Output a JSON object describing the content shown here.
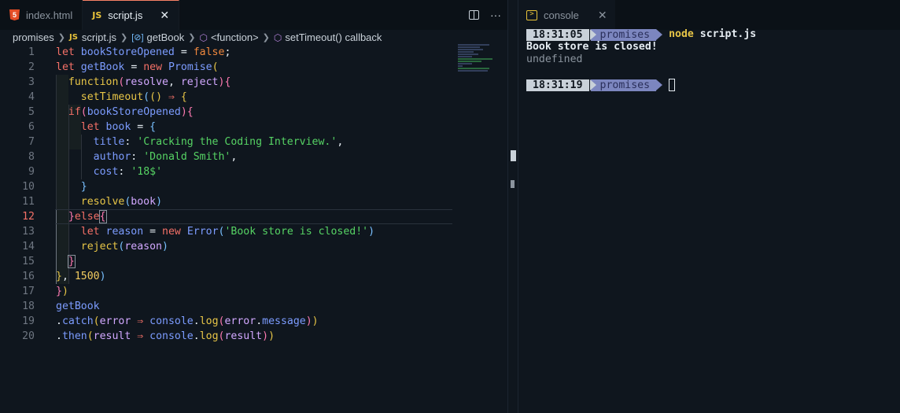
{
  "editor": {
    "tabs": [
      {
        "label": "index.html",
        "icon": "html5-icon"
      },
      {
        "label": "script.js",
        "icon": "js-icon",
        "icon_text": "JS",
        "active": true
      }
    ],
    "breadcrumb": {
      "folder": "promises",
      "file_icon": "JS",
      "file": "script.js",
      "var": "getBook",
      "fn": "<function>",
      "callback": "setTimeout() callback"
    },
    "current_line": 12
  },
  "terminal": {
    "tab_label": "console",
    "prompt1": {
      "time": "18:31:05",
      "dir": "promises",
      "cmd": "node",
      "arg": " script.js"
    },
    "output": [
      "Book store is closed!",
      "undefined"
    ],
    "prompt2": {
      "time": "18:31:19",
      "dir": "promises"
    }
  },
  "colors": {
    "keyword": "#f47067",
    "string": "#56d364",
    "variable": "#7c9cff",
    "function": "#e7c547",
    "accent": "#f78166"
  }
}
